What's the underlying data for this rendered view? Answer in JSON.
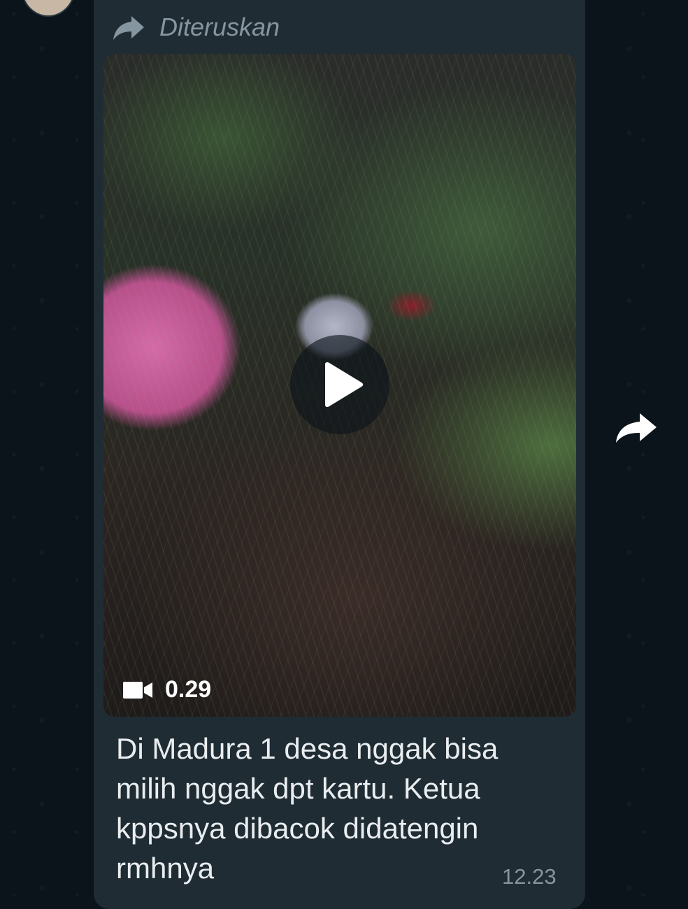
{
  "message": {
    "forwarded_label": "Diteruskan",
    "video": {
      "duration": "0.29",
      "icons": {
        "play": "play-icon",
        "camera": "video-camera-icon"
      }
    },
    "caption": "Di Madura 1 desa nggak bisa milih nggak dpt kartu. Ketua kppsnya dibacok didatengin rmhnya",
    "time": "12.23"
  },
  "icons": {
    "forward": "forward-arrow-icon",
    "share": "share-forward-icon"
  },
  "colors": {
    "chat_background": "#0b141a",
    "bubble": "#1f2c34",
    "secondary_text": "#8696a0",
    "primary_text": "#e9edef"
  }
}
